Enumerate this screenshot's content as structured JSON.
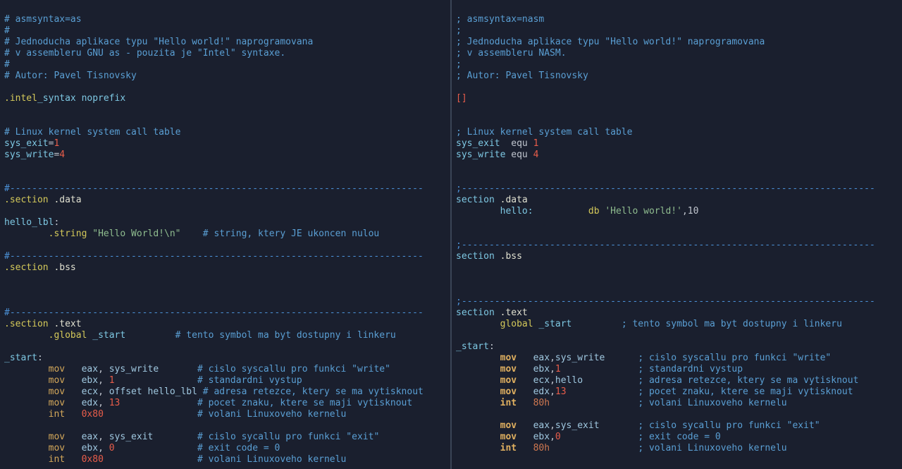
{
  "left": {
    "l1": "# asmsyntax=as",
    "l2": "#",
    "l3": "# Jednoducha aplikace typu \"Hello world!\" naprogramovana",
    "l4": "# v assembleru GNU as - pouzita je \"Intel\" syntaxe.",
    "l5": "#",
    "l6": "# Autor: Pavel Tisnovsky",
    "intel1": ".intel",
    "intel2": "_syntax noprefix",
    "lkc": "# Linux kernel system call table",
    "se": "sys_exit",
    "se_eq": "=",
    "se_v": "1",
    "sw": "sys_write",
    "sw_eq": "=",
    "sw_v": "4",
    "dash": "#---------------------------------------------------------------------------",
    "sec": ".section ",
    "data": ".data",
    "hello_lbl": "hello_lbl",
    "colon": ":",
    "string_dir": ".string ",
    "hello_str": "\"Hello World!\\n\"",
    "str_cmt": "    # string, ktery JE ukoncen nulou",
    "bss": ".bss",
    "text": ".text",
    "global": ".global ",
    "start": "_start",
    "start_cmt": "         # tento symbol ma byt dostupny i linkeru",
    "start_lbl": "_start",
    "mov": "mov",
    "int": "int",
    "eax": "eax",
    "ebx": "ebx",
    "ecx": "ecx",
    "edx": "edx",
    "comma": ", ",
    "sys_write": "sys_write",
    "sys_exit": "sys_exit",
    "one": "1",
    "zero": "0",
    "thirteen": "13",
    "hex80": "0x80",
    "offset": "offset hello_lbl",
    "c_write": "# cislo syscallu pro funkci \"write\"",
    "c_stdout": "# standardni vystup",
    "c_addr": "# adresa retezce, ktery se ma vytisknout",
    "c_count": "# pocet znaku, ktere se maji vytisknout",
    "c_kern": "# volani Linuxoveho kernelu",
    "c_exit": "# cislo sycallu pro funkci \"exit\"",
    "c_ecode": "# exit code = 0"
  },
  "right": {
    "l1": "; asmsyntax=nasm",
    "l2": ";",
    "l3": "; Jednoducha aplikace typu \"Hello world!\" naprogramovana",
    "l4": "; v assembleru NASM.",
    "l5": ";",
    "l6": "; Autor: Pavel Tisnovsky",
    "cursor": "[]",
    "lkc": "; Linux kernel system call table",
    "se": "sys_exit",
    "equ": "equ",
    "se_v": "1",
    "sw": "sys_write",
    "sw_v": "4",
    "dash": ";---------------------------------------------------------------------------",
    "sec": "section ",
    "data": ".data",
    "hello": "hello:",
    "db": "db",
    "hello_str": "'Hello world!'",
    "ten": ",10",
    "bss": ".bss",
    "text": ".text",
    "global": "global ",
    "start": "_start",
    "start_cmt": "         ; tento symbol ma byt dostupny i linkeru",
    "start_lbl": "_start",
    "mov": "mov",
    "int": "int",
    "eax": "eax",
    "ebx": "ebx",
    "ecx": "ecx",
    "edx": "edx",
    "comma": ",",
    "sys_write": "sys_write",
    "sys_exit": "sys_exit",
    "one": "1",
    "zero": "0",
    "thirteen": "13",
    "h80": "80h",
    "helloref": "hello",
    "c_write": "; cislo syscallu pro funkci \"write\"",
    "c_stdout": "; standardni vystup",
    "c_addr": "; adresa retezce, ktery se ma vytisknout",
    "c_count": "; pocet znaku, ktere se maji vytisknout",
    "c_kern": "; volani Linuxoveho kernelu",
    "c_exit": "; cislo sycallu pro funkci \"exit\"",
    "c_ecode": "; exit code = 0"
  }
}
